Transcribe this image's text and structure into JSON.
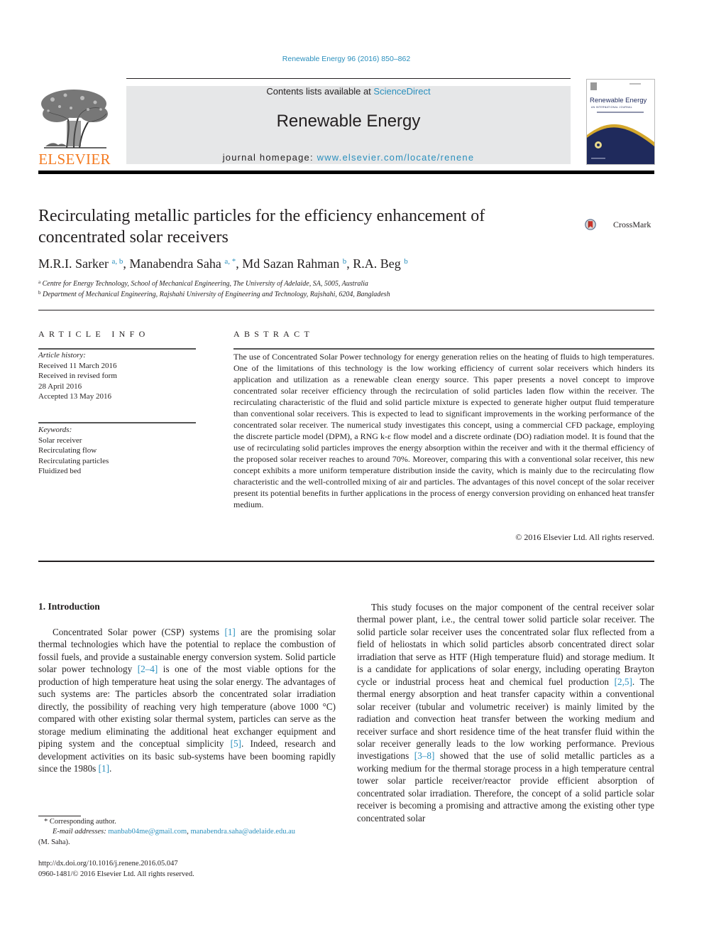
{
  "citation": "Renewable Energy 96 (2016) 850–862",
  "masthead": {
    "contents_prefix": "Contents lists available at ",
    "contents_link": "ScienceDirect",
    "journal_name": "Renewable Energy",
    "homepage_prefix": "journal homepage: ",
    "homepage_link": "www.elsevier.com/locate/renene",
    "publisher_logo_text": "ELSEVIER",
    "cover_title": "Renewable Energy",
    "cover_subtitle": "AN INTERNATIONAL JOURNAL"
  },
  "colors": {
    "link": "#2a8fbd",
    "elsevier_orange": "#f47a20",
    "masthead_gray": "#e6e7e8",
    "cover_navy": "#1f2a5c",
    "cover_gold": "#d4a72c"
  },
  "title": {
    "line1": "Recirculating metallic particles for the efficiency enhancement of",
    "line2": "concentrated solar receivers"
  },
  "crossmark_label": "CrossMark",
  "authors": [
    {
      "name": "M.R.I. Sarker",
      "affil": "a, b",
      "sep": ", "
    },
    {
      "name": "Manabendra Saha",
      "affil": "a, *",
      "sep": ", "
    },
    {
      "name": "Md Sazan Rahman",
      "affil": "b",
      "sep": ", "
    },
    {
      "name": "R.A. Beg",
      "affil": "b",
      "sep": ""
    }
  ],
  "affiliations": [
    {
      "mark": "a",
      "text": "Centre for Energy Technology, School of Mechanical Engineering, The University of Adelaide, SA, 5005, Australia"
    },
    {
      "mark": "b",
      "text": "Department of Mechanical Engineering, Rajshahi University of Engineering and Technology, Rajshahi, 6204, Bangladesh"
    }
  ],
  "article_info": {
    "heading": "ARTICLE INFO",
    "history_label": "Article history:",
    "history": [
      "Received 11 March 2016",
      "Received in revised form",
      "28 April 2016",
      "Accepted 13 May 2016"
    ],
    "keywords_label": "Keywords:",
    "keywords": [
      "Solar receiver",
      "Recirculating flow",
      "Recirculating particles",
      "Fluidized bed"
    ]
  },
  "abstract": {
    "heading": "ABSTRACT",
    "text": "The use of Concentrated Solar Power technology for energy generation relies on the heating of fluids to high temperatures. One of the limitations of this technology is the low working efficiency of current solar receivers which hinders its application and utilization as a renewable clean energy source. This paper presents a novel concept to improve concentrated solar receiver efficiency through the recirculation of solid particles laden flow within the receiver. The recirculating characteristic of the fluid and solid particle mixture is expected to generate higher output fluid temperature than conventional solar re­ceivers. This is expected to lead to significant improvements in the working performance of the concentrated solar receiver. The numerical study investigates this concept, using a commercial CFD package, employing the discrete particle model (DPM), a RNG k-ε flow model and a discrete ordinate (DO) radiation model. It is found that the use of recirculating solid particles improves the energy ab­sorption within the receiver and with it the thermal efficiency of the proposed solar receiver reaches to around 70%. Moreover, comparing this with a conventional solar receiver, this new concept exhibits a more uniform temperature distribution inside the cavity, which is mainly due to the recirculating flow characteristic and the well-controlled mixing of air and particles. The advantages of this novel concept of the solar receiver present its potential benefits in further applications in the process of energy conversion providing on enhanced heat transfer medium.",
    "copyright": "© 2016 Elsevier Ltd. All rights reserved."
  },
  "introduction": {
    "heading": "1.  Introduction",
    "left_paragraph": [
      {
        "t": "Concentrated Solar power (CSP) systems "
      },
      {
        "ref": "[1]"
      },
      {
        "t": " are the promising solar thermal technologies which have the potential to replace the combustion of fossil fuels, and provide a sustainable energy con­version system. Solid particle solar power technology "
      },
      {
        "ref": "[2–4]"
      },
      {
        "t": " is one of the most viable options for the production of high temperature heat using the solar energy. The advantages of such systems are: The particles absorb the concentrated solar irradiation directly, the possibility of reaching very high temperature (above 1000 °C) compared with other existing solar thermal system, particles can serve as the storage medium eliminating the additional heat exchanger equipment and piping system and the conceptual simplicity "
      },
      {
        "ref": "[5]"
      },
      {
        "t": ". Indeed, research and development activities on its basic sub-systems have been booming rapidly since the 1980s "
      },
      {
        "ref": "[1]"
      },
      {
        "t": "."
      }
    ],
    "right_paragraph": [
      {
        "t": "This study focuses on the major component of the central receiver solar thermal power plant, i.e., the central tower solid particle solar receiver. The solid particle solar receiver uses the concentrated solar flux reflected from a field of heliostats in which solid particles absorb concentrated direct solar irradiation that serve as HTF (High temperature fluid) and storage medium. It is a candidate for applications of solar energy, including operating Brayton cycle or industrial process heat and chemical fuel pro­duction "
      },
      {
        "ref": "[2,5]"
      },
      {
        "t": ". The thermal energy absorption and heat transfer capacity within a conventional solar receiver (tubular and volu­metric receiver) is mainly limited by the radiation and convection heat transfer between the working medium and receiver surface and short residence time of the heat transfer fluid within the solar receiver generally leads to the low working performance. Previous investigations "
      },
      {
        "ref": "[3–8]"
      },
      {
        "t": " showed that the use of solid metallic particles as a working medium for the thermal storage process in a high temperature central tower solar particle receiver/reactor provide efficient absorption of concentrated solar irradiation. Therefore, the concept of a solid particle solar receiver is becoming a promising and attractive among the existing other type concentrated solar"
      }
    ]
  },
  "footnotes": {
    "corresponding": "* Corresponding author.",
    "email_label": "E-mail addresses: ",
    "email1": "manbab04me@gmail.com",
    "email_sep": ", ",
    "email2": "manabendra.saha@adelaide.edu.au",
    "email_owner": "(M. Saha).",
    "doi": "http://dx.doi.org/10.1016/j.renene.2016.05.047",
    "issn": "0960-1481/© 2016 Elsevier Ltd. All rights reserved."
  }
}
